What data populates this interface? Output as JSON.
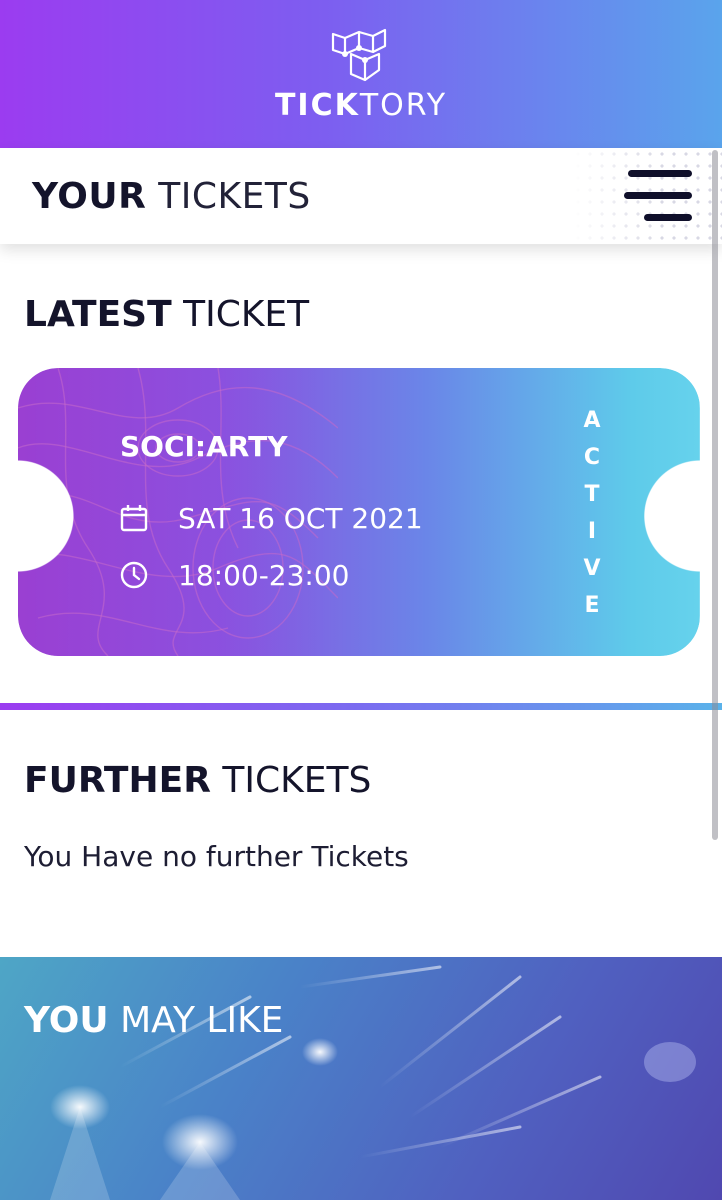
{
  "header": {
    "brand_bold": "TICK",
    "brand_light": "TORY",
    "colors": {
      "start": "#9b3cf0",
      "end": "#5aa4ec"
    }
  },
  "title_bar": {
    "title_bold": "YOUR",
    "title_light": " TICKETS",
    "menu_icon": "hamburger-icon"
  },
  "latest": {
    "heading_bold": "LATEST",
    "heading_light": " TICKET",
    "ticket": {
      "event": "SOCI:ARTY",
      "date": "SAT 16 OCT 2021",
      "time": "18:00-23:00",
      "status_letters": [
        "A",
        "C",
        "T",
        "I",
        "V",
        "E"
      ],
      "date_icon": "calendar-icon",
      "time_icon": "clock-icon"
    }
  },
  "further": {
    "heading_bold": "FURTHER",
    "heading_light": " TICKETS",
    "empty_message": "You Have no further Tickets"
  },
  "recommend": {
    "heading_bold": "YOU",
    "heading_light": " MAY LIKE"
  }
}
